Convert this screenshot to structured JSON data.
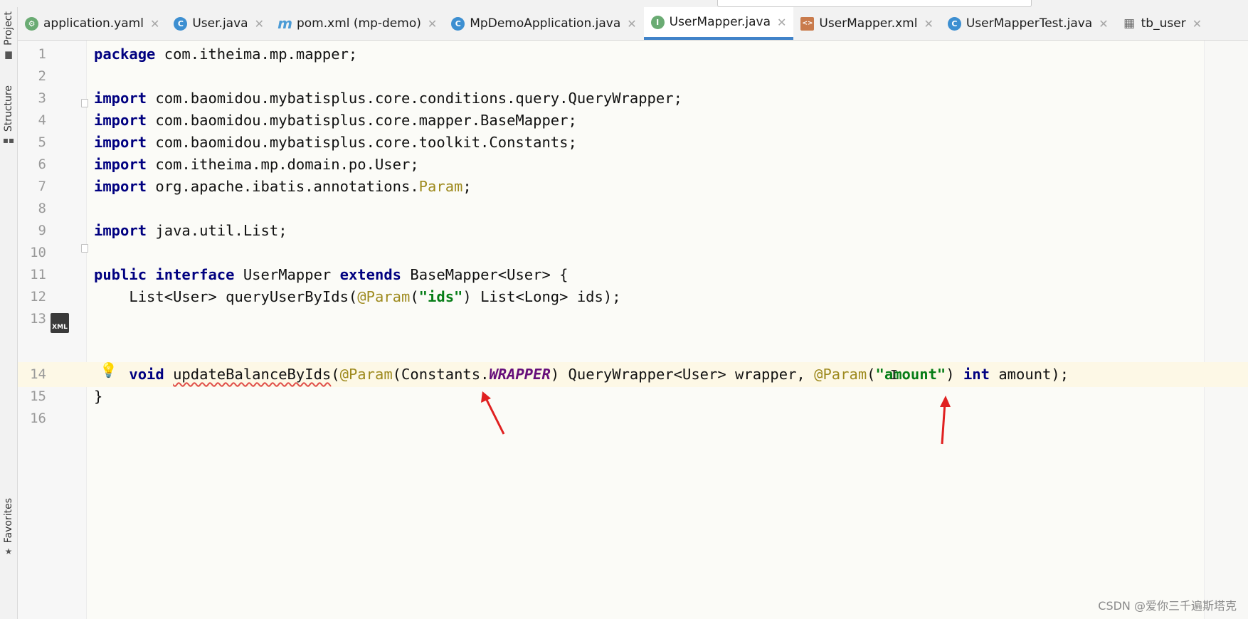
{
  "side_tabs": [
    {
      "label": "Project",
      "icon": "folder-icon"
    },
    {
      "label": "Structure",
      "icon": "structure-icon"
    },
    {
      "label": "Favorites",
      "icon": "star-icon"
    }
  ],
  "tabs": [
    {
      "label": "application.yaml",
      "icon": "yaml-config-icon",
      "icon_color": "#6aab73",
      "active": false
    },
    {
      "label": "User.java",
      "icon": "class-icon",
      "icon_color": "#3d8fd1",
      "active": false
    },
    {
      "label": "pom.xml (mp-demo)",
      "icon": "maven-icon",
      "icon_color": "#4b9bd6",
      "active": false
    },
    {
      "label": "MpDemoApplication.java",
      "icon": "spring-class-icon",
      "icon_color": "#3d8fd1",
      "active": false
    },
    {
      "label": "UserMapper.java",
      "icon": "interface-icon",
      "icon_color": "#6aab73",
      "active": true
    },
    {
      "label": "UserMapper.xml",
      "icon": "xml-file-icon",
      "icon_color": "#c97b4c",
      "active": false
    },
    {
      "label": "UserMapperTest.java",
      "icon": "test-class-icon",
      "icon_color": "#3d8fd1",
      "active": false
    },
    {
      "label": "tb_user",
      "icon": "table-icon",
      "icon_color": "#6b6b6b",
      "active": false
    }
  ],
  "editor": {
    "line_numbers": [
      "1",
      "2",
      "3",
      "4",
      "5",
      "6",
      "7",
      "8",
      "9",
      "10",
      "11",
      "12",
      "13",
      "14",
      "15",
      "16"
    ],
    "highlighted_line": "14",
    "lines": {
      "l1": [
        "package",
        " com.itheima.mp.mapper;"
      ],
      "l3": [
        "import",
        " com.baomidou.mybatisplus.core.conditions.query.QueryWrapper;"
      ],
      "l4": [
        "import",
        " com.baomidou.mybatisplus.core.mapper.BaseMapper;"
      ],
      "l5": [
        "import",
        " com.baomidou.mybatisplus.core.toolkit.Constants;"
      ],
      "l6": [
        "import",
        " com.itheima.mp.domain.po.User;"
      ],
      "l7": [
        "import",
        " org.apache.ibatis.annotations.",
        "Param",
        ";"
      ],
      "l9": [
        "import",
        " java.util.List;"
      ],
      "l11": [
        "public",
        " ",
        "interface",
        " UserMapper ",
        "extends",
        " BaseMapper<User> {"
      ],
      "l12": [
        "    List<User> queryUserByIds(",
        "@Param",
        "(",
        "\"ids\"",
        ") List<Long> ids);"
      ],
      "l14": [
        "    ",
        "void",
        " ",
        "updateBalanceByIds",
        "(",
        "@Param",
        "(Constants.",
        "WRAPPER",
        ") QueryWrapper<User> wrapper, ",
        "@Param",
        "(",
        "\"amount\"",
        ") ",
        "int",
        " amount);"
      ],
      "l15": [
        "}"
      ]
    }
  },
  "gutter": {
    "xml_icon_label": "XML"
  },
  "watermark": "CSDN @爱你三千遍斯塔克",
  "colors": {
    "keyword": "#000080",
    "annotation": "#9e8a1e",
    "string": "#067d17",
    "constant": "#660e7a",
    "active_tab_underline": "#4083c9",
    "arrow": "#e02020"
  }
}
